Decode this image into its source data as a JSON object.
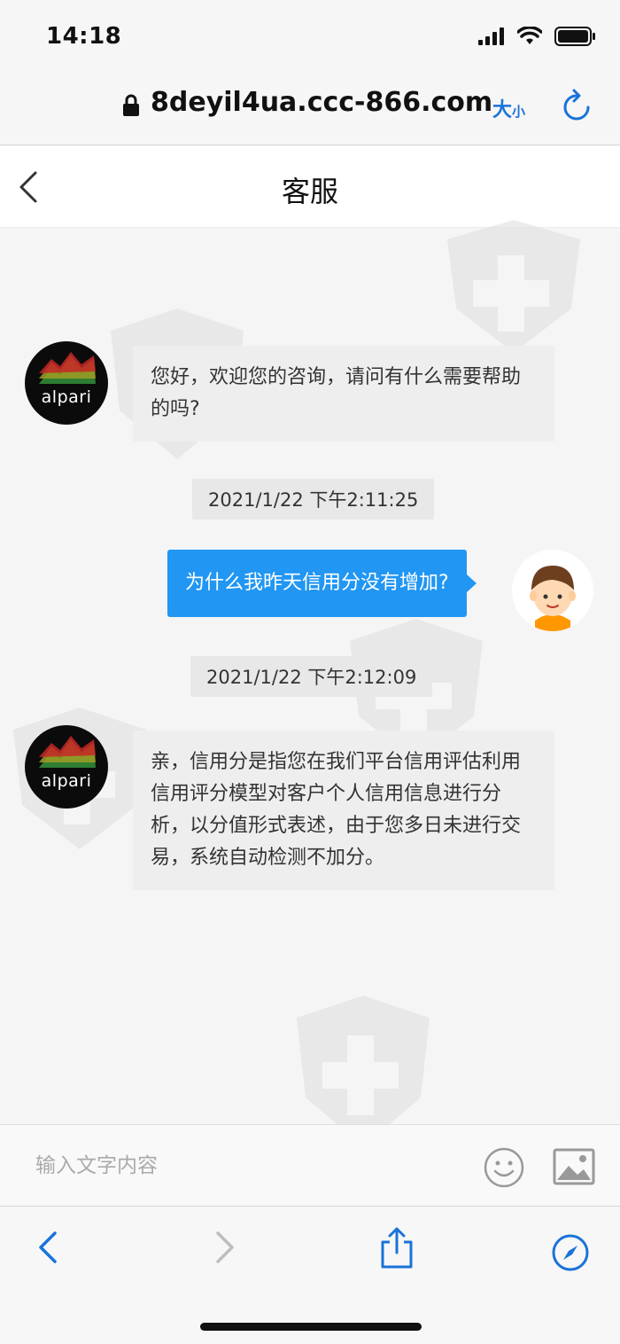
{
  "status_bar": {
    "time": "14:18"
  },
  "url_bar": {
    "url": "8deyil4ua.ccc-866.com",
    "text_size_big": "大",
    "text_size_small": "小"
  },
  "header": {
    "title": "客服"
  },
  "messages": [
    {
      "from": "agent",
      "brand": "alpari",
      "text": "您好，欢迎您的咨询，请问有什么需要帮助的吗?"
    },
    {
      "timestamp": "2021/1/22 下午2:11:25"
    },
    {
      "from": "user",
      "text": "为什么我昨天信用分没有增加?"
    },
    {
      "timestamp": "2021/1/22 下午2:12:09"
    },
    {
      "from": "agent",
      "brand": "alpari",
      "text": "亲，信用分是指您在我们平台信用评估利用信用评分模型对客户个人信用信息进行分析，以分值形式表述，由于您多日未进行交易，系统自动检测不加分。"
    }
  ],
  "input": {
    "placeholder": "输入文字内容"
  },
  "colors": {
    "accent": "#1a73d9",
    "user_bubble": "#2196f3",
    "agent_bubble": "#eeeeee"
  }
}
